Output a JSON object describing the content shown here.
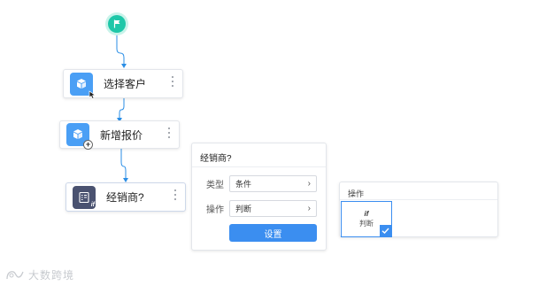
{
  "flow": {
    "start_icon": "flag-icon",
    "nodes": [
      {
        "label": "选择客户",
        "icon": "cube-cursor-icon"
      },
      {
        "label": "新增报价",
        "icon": "cube-plus-icon"
      },
      {
        "label": "经销商?",
        "icon": "condition-if-icon"
      }
    ]
  },
  "condition_panel": {
    "title": "经销商?",
    "type_label": "类型",
    "type_value": "条件",
    "operation_label": "操作",
    "operation_value": "判断",
    "settings_button": "设置"
  },
  "operation_panel": {
    "header": "操作",
    "tile_glyph": "if",
    "tile_label": "判断"
  },
  "watermark": {
    "text": "大数跨境"
  },
  "colors": {
    "start": "#1ec7a8",
    "connector": "#2a8ee6",
    "node_icon_blue": "#4a9ff5",
    "node_icon_dark": "#4a5270",
    "primary": "#3b8ef0"
  }
}
